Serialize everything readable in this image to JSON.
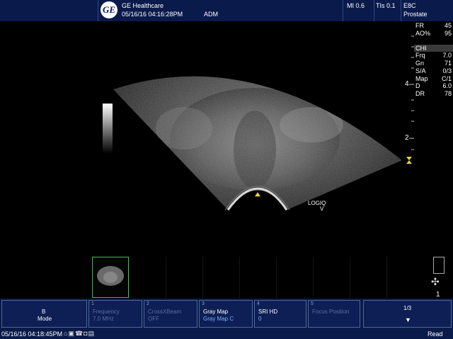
{
  "header": {
    "logo_text": "GE",
    "company": "GE Healthcare",
    "datetime": "05/16/16 04:16:28PM",
    "operator": "ADM",
    "mi": "MI 0.6",
    "tis": "TIs 0.1",
    "probe": "E8C",
    "preset": "Prostate"
  },
  "params": {
    "fr_label": "FR",
    "fr_value": "45",
    "ao_label": "AO%",
    "ao_value": "95",
    "mode_label": "CHI",
    "frq_label": "Frq",
    "frq_value": "7.0",
    "gn_label": "Gn",
    "gn_value": "71",
    "sa_label": "S/A",
    "sa_value": "0/3",
    "map_label": "Map",
    "map_value": "C/1",
    "d_label": "D",
    "d_value": "6.0",
    "dr_label": "DR",
    "dr_value": "78"
  },
  "depth_scale": {
    "mark_4": "4",
    "mark_2": "2"
  },
  "overlay": {
    "system_line1": "LOGIQ",
    "system_line2": "V"
  },
  "right_panel": {
    "page_number": "1"
  },
  "softkeys": [
    {
      "num": "",
      "line1": "B",
      "line2": "Mode"
    },
    {
      "num": "1",
      "line1": "Frequency",
      "line2": "7.0 MHz"
    },
    {
      "num": "2",
      "line1": "CrossXBeam",
      "line2": "OFF"
    },
    {
      "num": "3",
      "line1": "Gray Map",
      "line2": "Gray Map C"
    },
    {
      "num": "4",
      "line1": "SRI HD",
      "line2": "0"
    },
    {
      "num": "5",
      "line1": "Focus Position",
      "line2": ""
    },
    {
      "num": "",
      "line1": "1/3",
      "line2": ""
    }
  ],
  "status": {
    "datetime": "05/16/16 04:18:45PM",
    "state": "Read"
  },
  "colors": {
    "header_bg": "#0a1a4a",
    "softkey_bg": "#0d1f55",
    "thumb_border": "#3fbf3f",
    "focus_marker": "#e8d34a"
  },
  "icons": [
    "logo-icon",
    "grayscale-bar-icon",
    "focus-marker-icon",
    "cine-icon",
    "trackball-icon",
    "status-icons"
  ]
}
